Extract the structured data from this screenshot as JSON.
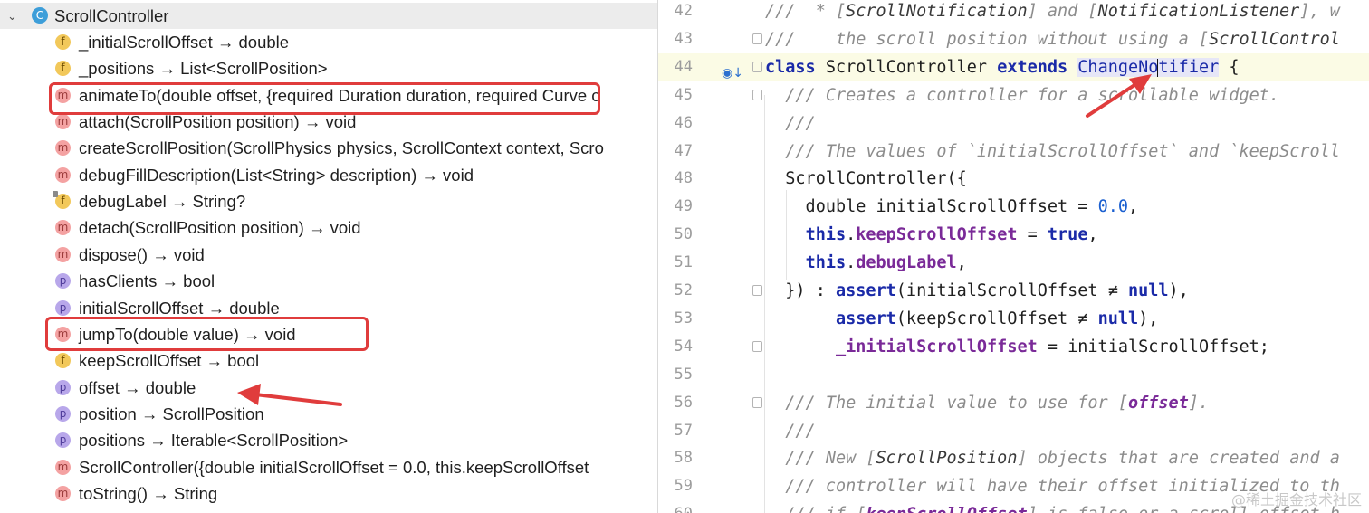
{
  "structure": {
    "class_name": "ScrollController",
    "class_icon": "C",
    "members": [
      {
        "kind": "f",
        "icon": "f",
        "label": "_initialScrollOffset → double",
        "lock": false
      },
      {
        "kind": "f",
        "icon": "f",
        "label": "_positions → List<ScrollPosition>",
        "lock": false
      },
      {
        "kind": "m",
        "icon": "m",
        "label": "animateTo(double offset, {required Duration duration, required Curve c",
        "lock": false
      },
      {
        "kind": "m",
        "icon": "m",
        "label": "attach(ScrollPosition position) → void",
        "lock": false
      },
      {
        "kind": "m",
        "icon": "m",
        "label": "createScrollPosition(ScrollPhysics physics, ScrollContext context, Scro",
        "lock": false
      },
      {
        "kind": "m",
        "icon": "m",
        "label": "debugFillDescription(List<String> description) → void",
        "lock": false
      },
      {
        "kind": "f",
        "icon": "f",
        "label": "debugLabel → String?",
        "lock": true
      },
      {
        "kind": "m",
        "icon": "m",
        "label": "detach(ScrollPosition position) → void",
        "lock": false
      },
      {
        "kind": "m",
        "icon": "m",
        "label": "dispose() → void",
        "lock": false
      },
      {
        "kind": "p",
        "icon": "p",
        "label": "hasClients → bool",
        "lock": false
      },
      {
        "kind": "p",
        "icon": "p",
        "label": "initialScrollOffset → double",
        "lock": false
      },
      {
        "kind": "m",
        "icon": "m",
        "label": "jumpTo(double value) → void",
        "lock": false
      },
      {
        "kind": "f",
        "icon": "f",
        "label": "keepScrollOffset → bool",
        "lock": false
      },
      {
        "kind": "p",
        "icon": "p",
        "label": "offset → double",
        "lock": false
      },
      {
        "kind": "p",
        "icon": "p",
        "label": "position → ScrollPosition",
        "lock": false
      },
      {
        "kind": "p",
        "icon": "p",
        "label": "positions → Iterable<ScrollPosition>",
        "lock": false
      },
      {
        "kind": "m",
        "icon": "m",
        "label": "ScrollController({double initialScrollOffset = 0.0, this.keepScrollOffset",
        "lock": false
      },
      {
        "kind": "m",
        "icon": "m",
        "label": "toString() → String",
        "lock": false
      }
    ]
  },
  "editor": {
    "lines": [
      {
        "n": "42",
        "tokens": [
          [
            "doc",
            "///  * ["
          ],
          [
            "docref",
            "ScrollNotification"
          ],
          [
            "doc",
            "] and ["
          ],
          [
            "docref",
            "NotificationListener"
          ],
          [
            "doc",
            "], w"
          ]
        ]
      },
      {
        "n": "43",
        "tokens": [
          [
            "doc",
            "///    the scroll position without using a ["
          ],
          [
            "docref",
            "ScrollControl"
          ]
        ]
      },
      {
        "n": "44",
        "tokens": [
          [
            "kw",
            "class"
          ],
          [
            "sym",
            " ScrollController "
          ],
          [
            "kw",
            "extends"
          ],
          [
            "sym",
            " "
          ],
          [
            "hlw",
            "ChangeNo"
          ],
          [
            "caret",
            ""
          ],
          [
            "hlw",
            "tifier"
          ],
          [
            "sym",
            " {"
          ]
        ]
      },
      {
        "n": "45",
        "tokens": [
          [
            "doc",
            "  /// Creates a controller for a scrollable widget."
          ]
        ]
      },
      {
        "n": "46",
        "tokens": [
          [
            "doc",
            "  ///"
          ]
        ]
      },
      {
        "n": "47",
        "tokens": [
          [
            "doc",
            "  /// The values of `initialScrollOffset` and `keepScroll"
          ]
        ]
      },
      {
        "n": "48",
        "tokens": [
          [
            "sym",
            "  ScrollController({"
          ]
        ]
      },
      {
        "n": "49",
        "tokens": [
          [
            "sym",
            "    double initialScrollOffset = "
          ],
          [
            "num",
            "0.0"
          ],
          [
            "sym",
            ","
          ]
        ]
      },
      {
        "n": "50",
        "tokens": [
          [
            "sym",
            "    "
          ],
          [
            "kw",
            "this"
          ],
          [
            "sym",
            "."
          ],
          [
            "fld",
            "keepScrollOffset"
          ],
          [
            "sym",
            " = "
          ],
          [
            "kw",
            "true"
          ],
          [
            "sym",
            ","
          ]
        ]
      },
      {
        "n": "51",
        "tokens": [
          [
            "sym",
            "    "
          ],
          [
            "kw",
            "this"
          ],
          [
            "sym",
            "."
          ],
          [
            "fld",
            "debugLabel"
          ],
          [
            "sym",
            ","
          ]
        ]
      },
      {
        "n": "52",
        "tokens": [
          [
            "sym",
            "  }) : "
          ],
          [
            "kw",
            "assert"
          ],
          [
            "sym",
            "(initialScrollOffset ≠ "
          ],
          [
            "kw",
            "null"
          ],
          [
            "sym",
            "),"
          ]
        ]
      },
      {
        "n": "53",
        "tokens": [
          [
            "sym",
            "       "
          ],
          [
            "kw",
            "assert"
          ],
          [
            "sym",
            "(keepScrollOffset ≠ "
          ],
          [
            "kw",
            "null"
          ],
          [
            "sym",
            "),"
          ]
        ]
      },
      {
        "n": "54",
        "tokens": [
          [
            "sym",
            "       "
          ],
          [
            "fld",
            "_initialScrollOffset"
          ],
          [
            "sym",
            " = initialScrollOffset;"
          ]
        ]
      },
      {
        "n": "55",
        "tokens": []
      },
      {
        "n": "56",
        "tokens": [
          [
            "doc",
            "  /// The initial value to use for ["
          ],
          [
            "fldi",
            "offset"
          ],
          [
            "doc",
            "]."
          ]
        ]
      },
      {
        "n": "57",
        "tokens": [
          [
            "doc",
            "  ///"
          ]
        ]
      },
      {
        "n": "58",
        "tokens": [
          [
            "doc",
            "  /// New ["
          ],
          [
            "docref",
            "ScrollPosition"
          ],
          [
            "doc",
            "] objects that are created and a"
          ]
        ]
      },
      {
        "n": "59",
        "tokens": [
          [
            "doc",
            "  /// controller will have their offset initialized to th"
          ]
        ]
      },
      {
        "n": "60",
        "tokens": [
          [
            "doc",
            "  /// if ["
          ],
          [
            "fldi",
            "keepScrollOffset"
          ],
          [
            "doc",
            "] is false or a scroll offset h"
          ]
        ]
      }
    ]
  },
  "watermark": "@稀土掘金技术社区",
  "colors": {
    "highlight_box": "#e03c3c",
    "arrow": "#e03c3c"
  }
}
